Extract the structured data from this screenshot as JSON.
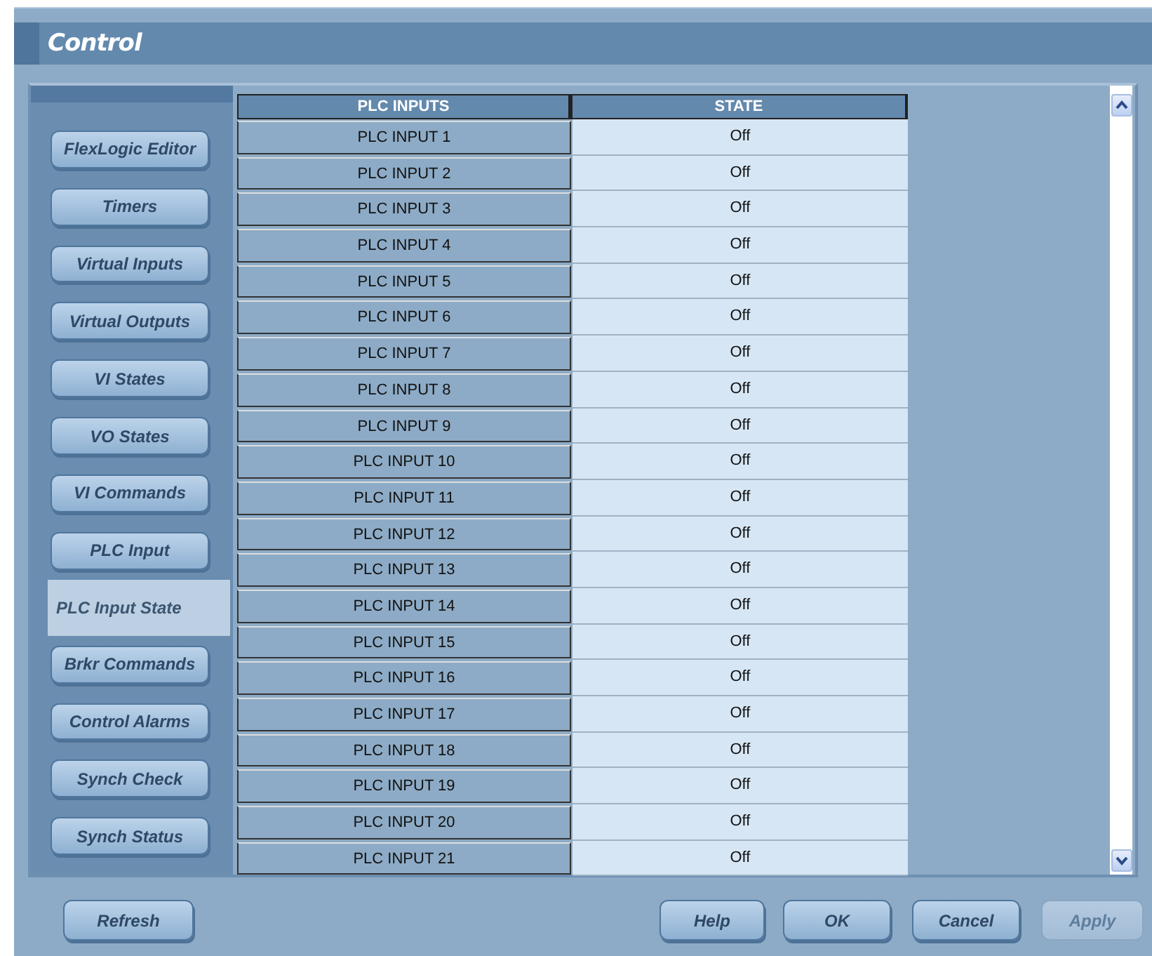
{
  "window": {
    "title": "Control"
  },
  "sidebar": {
    "items": [
      {
        "label": "FlexLogic Editor",
        "selected": false
      },
      {
        "label": "Timers",
        "selected": false
      },
      {
        "label": "Virtual Inputs",
        "selected": false
      },
      {
        "label": "Virtual Outputs",
        "selected": false
      },
      {
        "label": "VI States",
        "selected": false
      },
      {
        "label": "VO States",
        "selected": false
      },
      {
        "label": "VI Commands",
        "selected": false
      },
      {
        "label": "PLC Input",
        "selected": false
      },
      {
        "label": "PLC Input State",
        "selected": true
      },
      {
        "label": "Brkr Commands",
        "selected": false
      },
      {
        "label": "Control Alarms",
        "selected": false
      },
      {
        "label": "Synch Check",
        "selected": false
      },
      {
        "label": "Synch Status",
        "selected": false
      }
    ]
  },
  "table": {
    "columns": [
      "PLC INPUTS",
      "STATE"
    ],
    "rows": [
      [
        "PLC INPUT 1",
        "Off"
      ],
      [
        "PLC INPUT 2",
        "Off"
      ],
      [
        "PLC INPUT 3",
        "Off"
      ],
      [
        "PLC INPUT 4",
        "Off"
      ],
      [
        "PLC INPUT 5",
        "Off"
      ],
      [
        "PLC INPUT 6",
        "Off"
      ],
      [
        "PLC INPUT 7",
        "Off"
      ],
      [
        "PLC INPUT 8",
        "Off"
      ],
      [
        "PLC INPUT 9",
        "Off"
      ],
      [
        "PLC INPUT 10",
        "Off"
      ],
      [
        "PLC INPUT 11",
        "Off"
      ],
      [
        "PLC INPUT 12",
        "Off"
      ],
      [
        "PLC INPUT 13",
        "Off"
      ],
      [
        "PLC INPUT 14",
        "Off"
      ],
      [
        "PLC INPUT 15",
        "Off"
      ],
      [
        "PLC INPUT 16",
        "Off"
      ],
      [
        "PLC INPUT 17",
        "Off"
      ],
      [
        "PLC INPUT 18",
        "Off"
      ],
      [
        "PLC INPUT 19",
        "Off"
      ],
      [
        "PLC INPUT 20",
        "Off"
      ],
      [
        "PLC INPUT 21",
        "Off"
      ]
    ]
  },
  "buttons": [
    {
      "label": "Refresh",
      "disabled": false
    },
    {
      "label": "Help",
      "disabled": false
    },
    {
      "label": "OK",
      "disabled": false
    },
    {
      "label": "Cancel",
      "disabled": false
    },
    {
      "label": "Apply",
      "disabled": true
    }
  ]
}
